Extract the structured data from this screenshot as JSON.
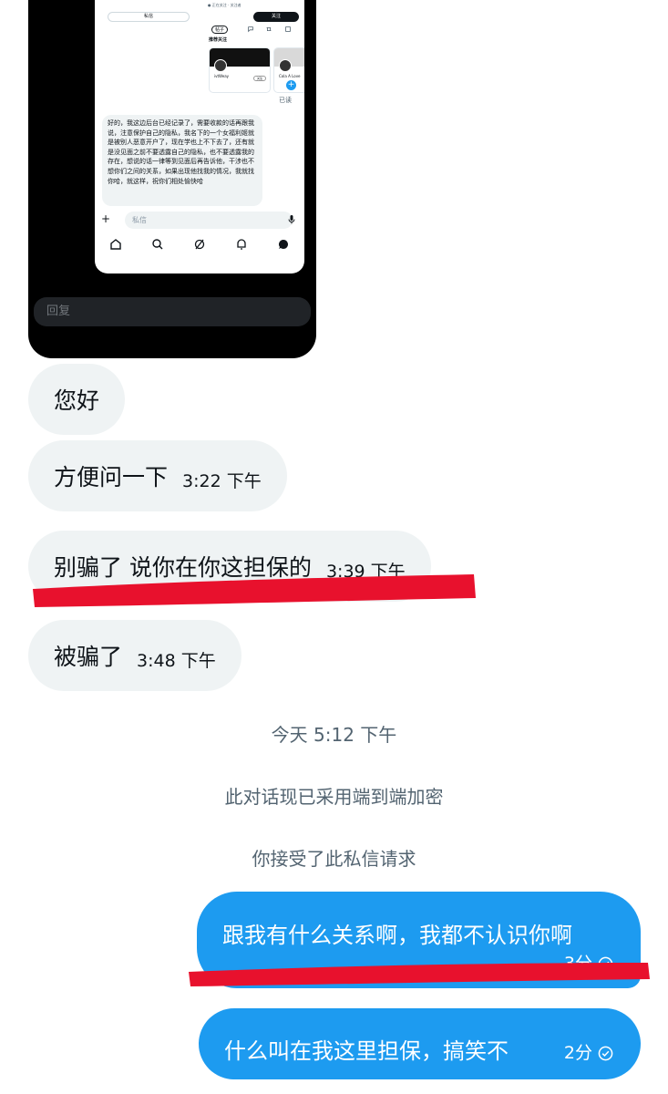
{
  "shot": {
    "tiny_status": "● 正在关注 · 关注者",
    "message_button": "私信",
    "follow_button": "关注",
    "tabs": [
      "帖子",
      "",
      "",
      ""
    ],
    "recommended_title": "推荐关注",
    "cards": [
      {
        "name": "ivtWeay",
        "handle": "@ivt77tsyy",
        "follow": "关注"
      },
      {
        "name": "Cola A Love",
        "handle": "@Co",
        "follow": "关注"
      }
    ],
    "read_status": "已读",
    "message_text": "好的，我这边后台已经记录了，需要收款的话再跟我说，注意保护自己的隐私，我名下的一个女福利姬就是被别人恶意开户了，现在学也上不下去了，还有就是没见面之前不要透露自己的隐私，也不要透露我的存在，想说的话一律等到见面后再告诉他，干涉也不想你们之间的关系，如果出现他找我的情况，我就找你哈，就这样，祝你们相处愉快哈",
    "compose_placeholder": "私信",
    "reply_placeholder": "回复"
  },
  "messages_in": [
    {
      "text": "您好",
      "time": ""
    },
    {
      "text": "方便问一下",
      "time": "3:22 下午"
    },
    {
      "text": "别骗了 说你在你这担保的",
      "time": "3:39 下午"
    },
    {
      "text": "被骗了",
      "time": "3:48 下午"
    }
  ],
  "system": {
    "date": "今天 5:12 下午",
    "encrypted": "此对话现已采用端到端加密",
    "accepted": "你接受了此私信请求"
  },
  "messages_out": [
    {
      "text": "跟我有什么关系啊，我都不认识你啊",
      "time": "3分"
    },
    {
      "text": "什么叫在我这里担保，搞笑不",
      "time": "2分"
    }
  ],
  "colors": {
    "incoming_bubble": "#eff3f4",
    "outgoing_bubble": "#1d9bf0",
    "highlight_stroke": "#e8112d"
  }
}
